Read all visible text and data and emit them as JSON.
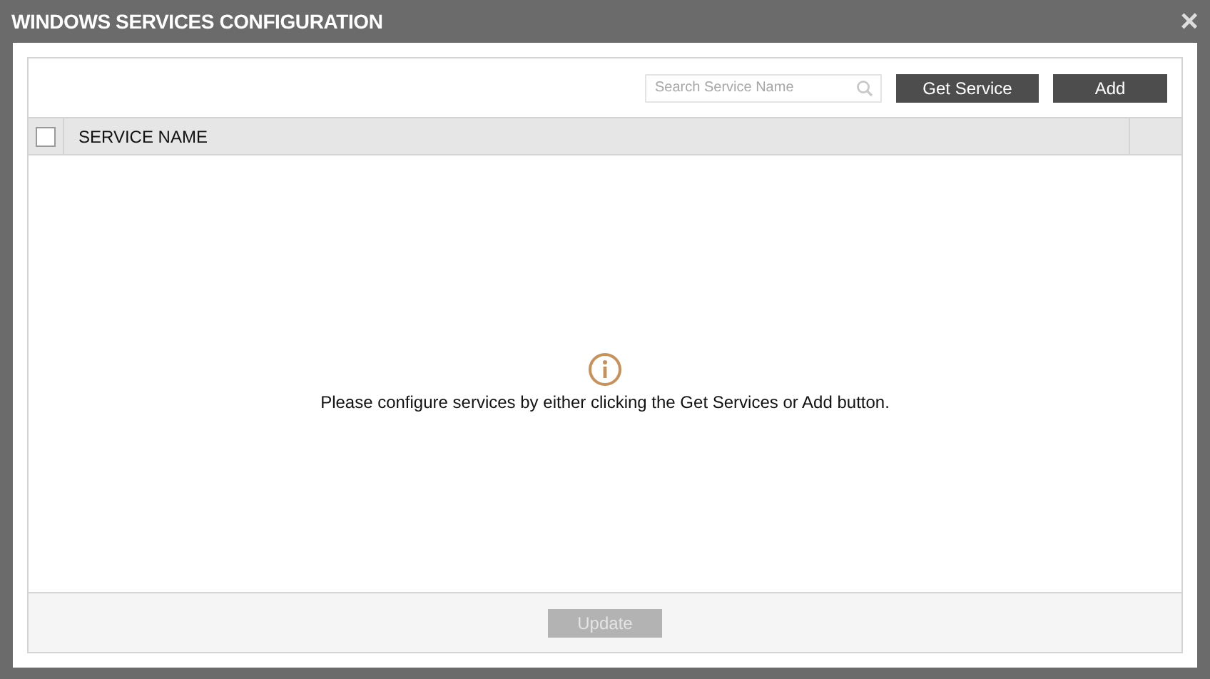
{
  "window": {
    "title": "WINDOWS SERVICES CONFIGURATION",
    "close": "×"
  },
  "toolbar": {
    "search": {
      "placeholder": "Search Service Name"
    },
    "buttons": [
      "Get Service",
      "Add"
    ]
  },
  "table": {
    "select_all": {
      "checked": false
    },
    "columns": [
      "SERVICE NAME"
    ]
  },
  "empty_message": "Please configure services by either clicking the Get Services or Add button.",
  "footer": {
    "button": {
      "label": "Update",
      "disabled": true
    }
  }
}
